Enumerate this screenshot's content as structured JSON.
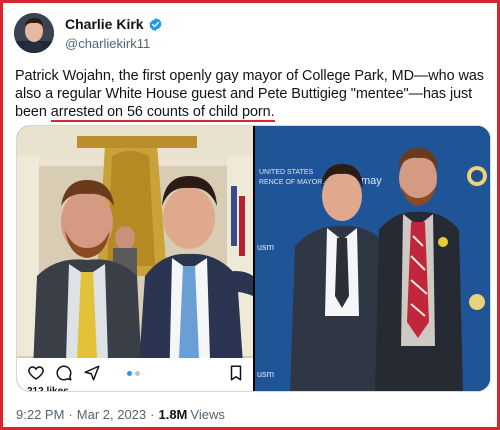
{
  "author": {
    "display_name": "Charlie Kirk",
    "handle": "@charliekirk11",
    "verified": true,
    "verified_color": "#1d9bf0"
  },
  "tweet": {
    "text_parts": [
      "Patrick Wojahn, the first openly gay mayor of College Park, MD—who was also a regular White House guest and Pete Buttigieg \"mentee\"—has just been ",
      "arrested on 56 counts of child porn.",
      ""
    ]
  },
  "media": {
    "photo_right_sign_1": "UNITED STATES",
    "photo_right_sign_2": "RENCE OF MAYORS",
    "photo_right_sign_3": "may",
    "photo_right_sign_4": "usm",
    "photo_right_sign_5": "usm",
    "photo_left_likes": "212 likes",
    "icons": [
      "heart-icon",
      "comment-icon",
      "share-icon",
      "bookmark-icon"
    ]
  },
  "meta": {
    "time": "9:22 PM",
    "separator": "·",
    "date": "Mar 2, 2023",
    "views_count": "1.8M",
    "views_label": "Views"
  },
  "colors": {
    "frame_red": "#d9262e",
    "text": "#0f1419",
    "muted": "#536471",
    "accent": "#1d9bf0"
  }
}
